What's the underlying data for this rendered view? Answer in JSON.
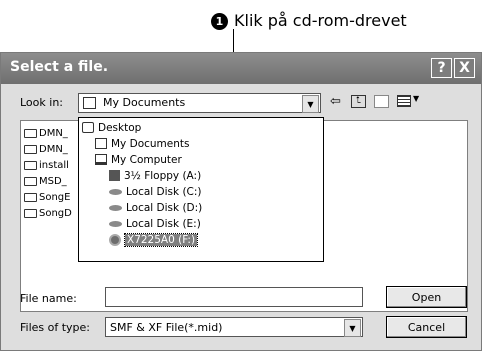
{
  "callout": {
    "number": "1",
    "text": "Klik på cd-rom-drevet"
  },
  "dialog": {
    "title": "Select a file.",
    "help_btn": "?",
    "close_btn": "X",
    "look_in_label": "Look in:",
    "look_in_value": "My Documents",
    "folders": [
      "DMN_",
      "DMN_",
      "install",
      "MSD_",
      "SongE",
      "SongD"
    ],
    "dropdown_items": [
      {
        "label": "Desktop",
        "icon": "desktop-icon"
      },
      {
        "label": "My Documents",
        "icon": "documents-icon"
      },
      {
        "label": "My Computer",
        "icon": "computer-icon"
      },
      {
        "label": "3½ Floppy (A:)",
        "icon": "floppy-icon"
      },
      {
        "label": "Local Disk (C:)",
        "icon": "disk-icon"
      },
      {
        "label": "Local Disk (D:)",
        "icon": "disk-icon"
      },
      {
        "label": "Local Disk (E:)",
        "icon": "disk-icon"
      },
      {
        "label": "X7225A0 (F:)",
        "icon": "cdrom-icon",
        "selected": true
      }
    ],
    "file_name_label": "File name:",
    "file_name_value": "",
    "files_of_type_label": "Files of type:",
    "files_of_type_value": "SMF & XF File(*.mid)",
    "open_btn": "Open",
    "cancel_btn": "Cancel"
  }
}
